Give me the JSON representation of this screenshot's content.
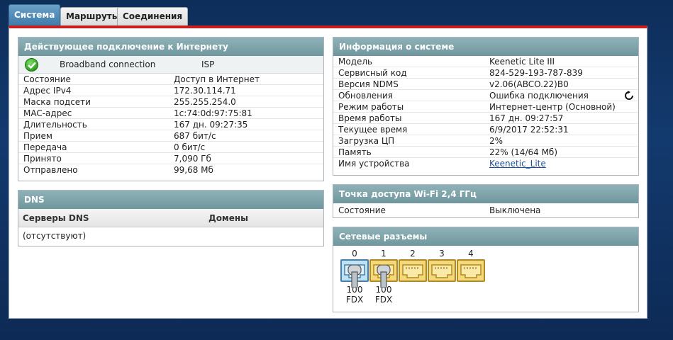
{
  "tabs": [
    {
      "label": "Система",
      "active": true
    },
    {
      "label": "Маршруты",
      "active": false
    },
    {
      "label": "Соединения",
      "active": false
    }
  ],
  "internet": {
    "title": "Действующее подключение к Интернету",
    "connection_name": "Broadband connection",
    "connection_type": "ISP",
    "status_icon": "check-circle-icon",
    "rows": [
      {
        "label": "Состояние",
        "value": "Доступ в Интернет"
      },
      {
        "label": "Адрес IPv4",
        "value": "172.30.114.71"
      },
      {
        "label": "Маска подсети",
        "value": "255.255.254.0"
      },
      {
        "label": "MAC-адрес",
        "value": "1c:74:0d:97:75:81"
      },
      {
        "label": "Длительность",
        "value": "167 дн. 09:27:35"
      },
      {
        "label": "Прием",
        "value": "687 бит/с"
      },
      {
        "label": "Передача",
        "value": "0 бит/с"
      },
      {
        "label": "Принято",
        "value": "7,090 Гб"
      },
      {
        "label": "Отправлено",
        "value": "99,68 Мб"
      }
    ]
  },
  "dns": {
    "title": "DNS",
    "col_servers": "Серверы DNS",
    "col_domains": "Домены",
    "empty_text": "(отсутствуют)"
  },
  "sysinfo": {
    "title": "Информация о системе",
    "rows": [
      {
        "label": "Модель",
        "value": "Keenetic Lite III"
      },
      {
        "label": "Сервисный код",
        "value": "824-529-193-787-839"
      },
      {
        "label": "Версия NDMS",
        "value": "v2.06(ABCO.22)B0"
      },
      {
        "label": "Обновления",
        "value": "Ошибка подключения"
      },
      {
        "label": "Режим работы",
        "value": "Интернет-центр (Основной)"
      },
      {
        "label": "Время работы",
        "value": "167 дн. 09:27:57"
      },
      {
        "label": "Текущее время",
        "value": "6/9/2017 22:52:31"
      },
      {
        "label": "Загрузка ЦП",
        "value": "2%"
      },
      {
        "label": "Память",
        "value": "22% (14/64 Мб)"
      },
      {
        "label": "Имя устройства",
        "value": "Keenetic_Lite"
      }
    ]
  },
  "wifi": {
    "title": "Точка доступа Wi-Fi 2,4 ГГц",
    "status_label": "Состояние",
    "status_value": "Выключена"
  },
  "ports": {
    "title": "Сетевые разъемы",
    "items": [
      {
        "num": "0",
        "speed": "100",
        "duplex": "FDX",
        "plugged": true
      },
      {
        "num": "1",
        "speed": "100",
        "duplex": "FDX",
        "plugged": true
      },
      {
        "num": "2",
        "speed": "",
        "duplex": "",
        "plugged": false
      },
      {
        "num": "3",
        "speed": "",
        "duplex": "",
        "plugged": false
      },
      {
        "num": "4",
        "speed": "",
        "duplex": "",
        "plugged": false
      }
    ]
  }
}
